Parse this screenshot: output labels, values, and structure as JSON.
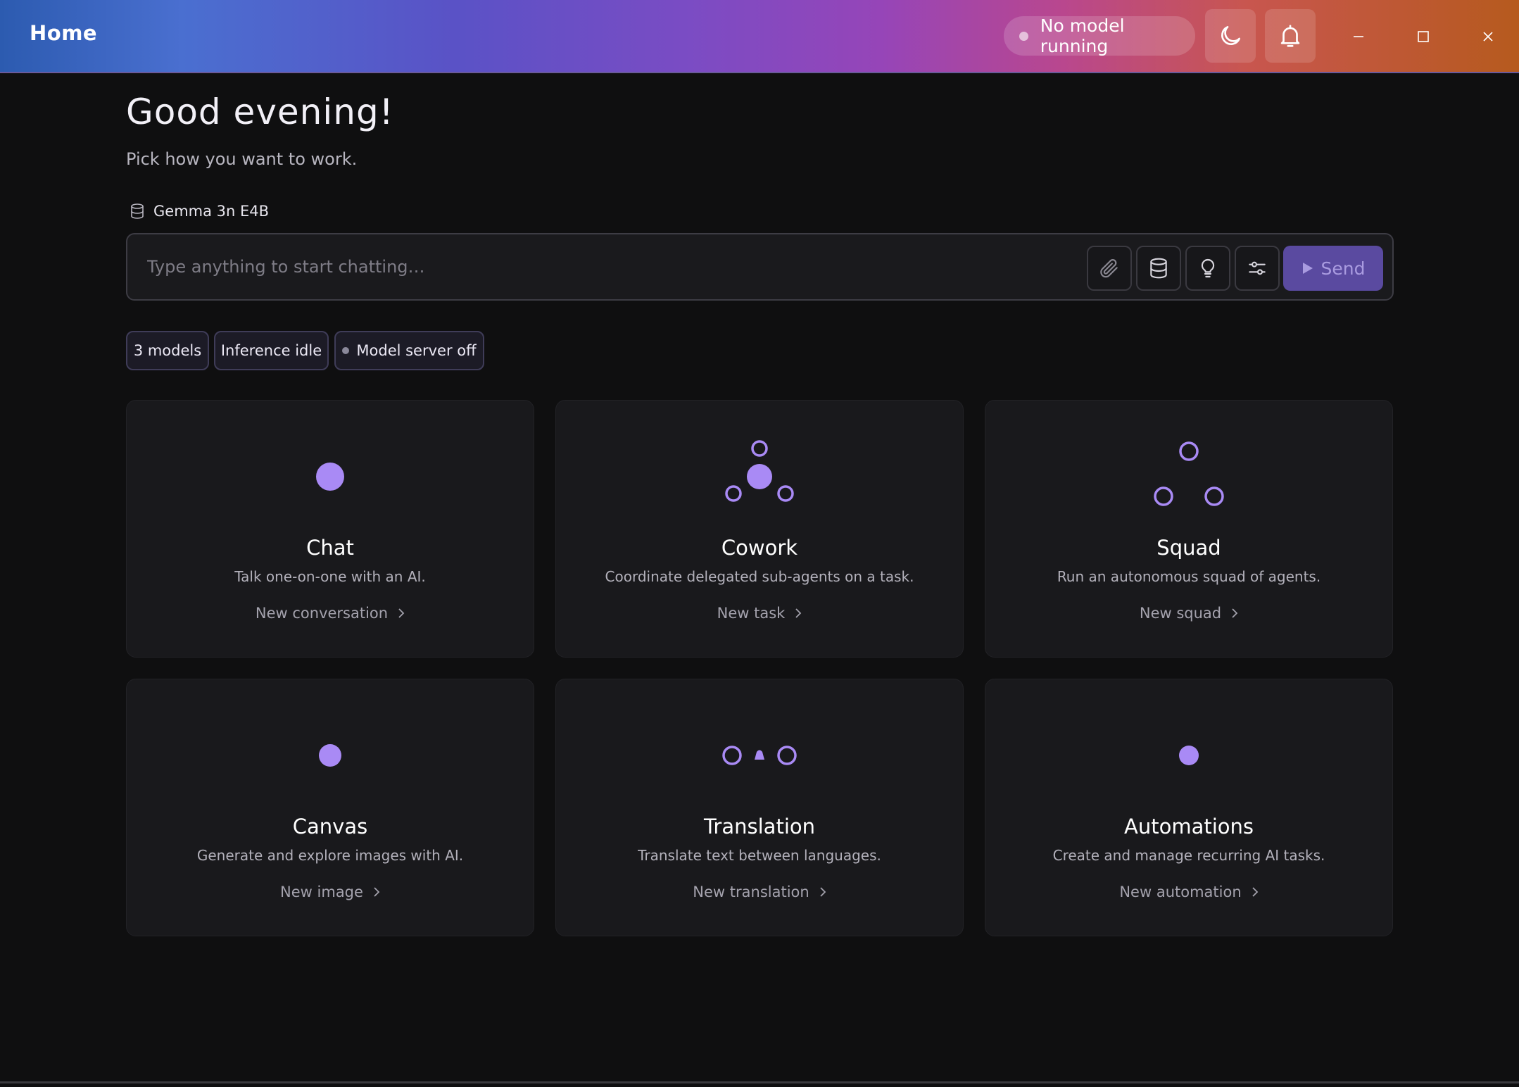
{
  "window": {
    "title": "Home",
    "status": "No model running"
  },
  "header": {
    "greeting": "Good evening!",
    "subtitle": "Pick how you want to work."
  },
  "composer": {
    "model_name": "Gemma 3n E4B",
    "placeholder": "Type anything to start chatting…",
    "send_label": "Send"
  },
  "chips": [
    {
      "label": "3 models"
    },
    {
      "label": "Inference idle"
    },
    {
      "label": "Model server off"
    }
  ],
  "cards": [
    {
      "title": "Chat",
      "description": "Talk one-on-one with an AI.",
      "link": "New conversation"
    },
    {
      "title": "Cowork",
      "description": "Coordinate delegated sub-agents on a task.",
      "link": "New task"
    },
    {
      "title": "Squad",
      "description": "Run an autonomous squad of agents.",
      "link": "New squad"
    },
    {
      "title": "Canvas",
      "description": "Generate and explore images with AI.",
      "link": "New image"
    },
    {
      "title": "Translation",
      "description": "Translate text between languages.",
      "link": "New translation"
    },
    {
      "title": "Automations",
      "description": "Create and manage recurring AI tasks.",
      "link": "New automation"
    }
  ],
  "colors": {
    "accent": "#a98af5",
    "background": "#0f0f10",
    "card": "#19191c",
    "send": "#5a4aa0"
  },
  "icons": {
    "theme": "moon-icon",
    "notifications": "bell-icon",
    "attach": "paperclip-icon",
    "knowledge": "database-icon",
    "ideas": "lightbulb-icon",
    "settings": "sliders-icon"
  }
}
